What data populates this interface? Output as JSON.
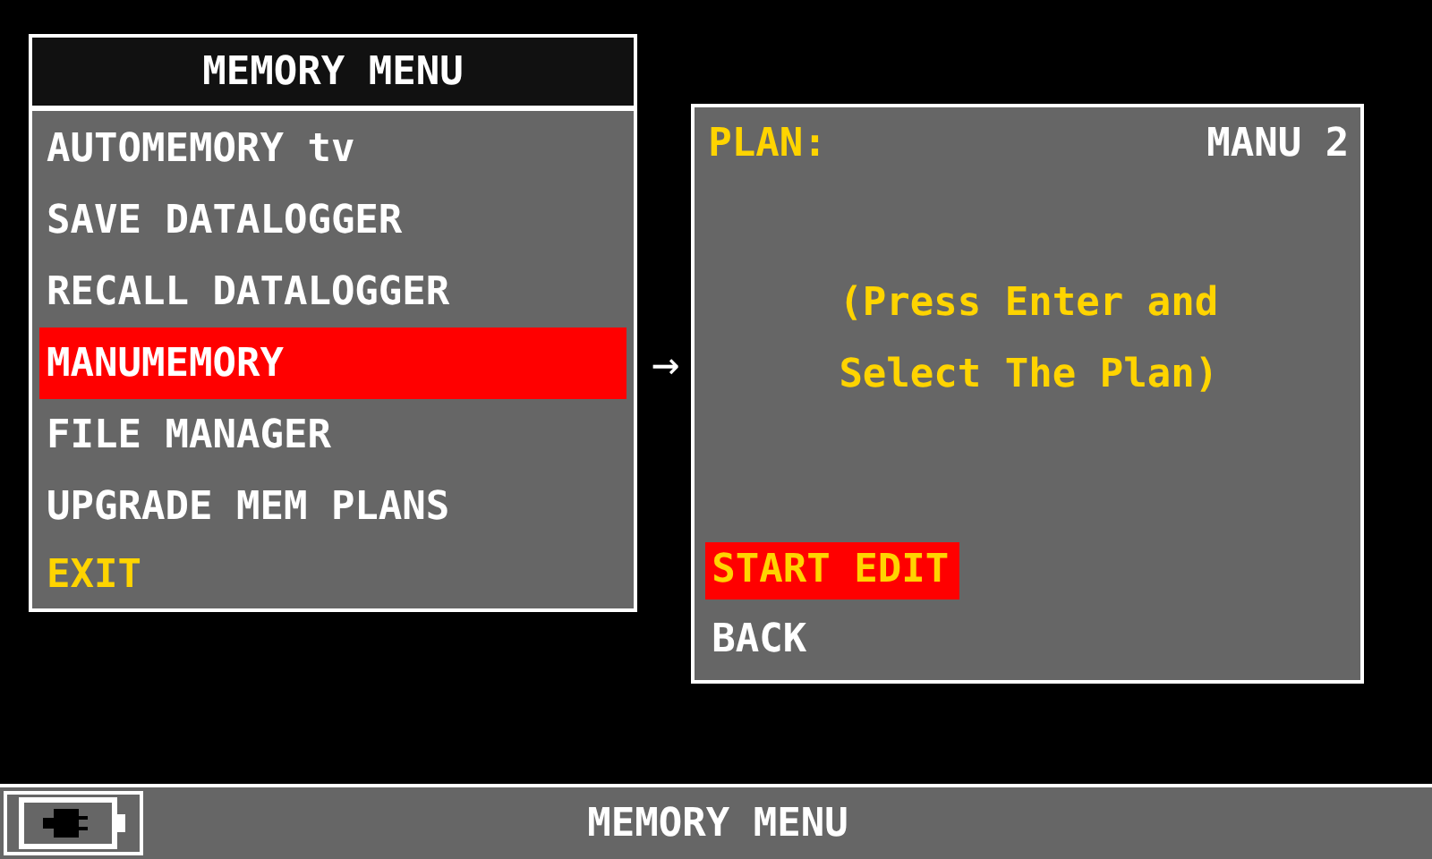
{
  "menu": {
    "title": "MEMORY MENU",
    "items": [
      {
        "label": "AUTOMEMORY tv",
        "kind": "normal",
        "selected": false
      },
      {
        "label": "SAVE DATALOGGER",
        "kind": "normal",
        "selected": false
      },
      {
        "label": "RECALL DATALOGGER",
        "kind": "normal",
        "selected": false
      },
      {
        "label": "MANUMEMORY",
        "kind": "normal",
        "selected": true
      },
      {
        "label": "FILE MANAGER",
        "kind": "normal",
        "selected": false
      },
      {
        "label": "UPGRADE MEM PLANS",
        "kind": "normal",
        "selected": false
      },
      {
        "label": "EXIT",
        "kind": "exit",
        "selected": false
      }
    ]
  },
  "arrow": "→",
  "submenu": {
    "plan_label": "PLAN:",
    "plan_value": "MANU 2",
    "message": [
      "(Press Enter and",
      "Select The Plan)"
    ],
    "options": [
      {
        "label": "START EDIT",
        "kind": "action",
        "selected": true
      },
      {
        "label": "BACK",
        "kind": "normal",
        "selected": false
      }
    ]
  },
  "status_bar": {
    "title": "MEMORY MENU"
  }
}
